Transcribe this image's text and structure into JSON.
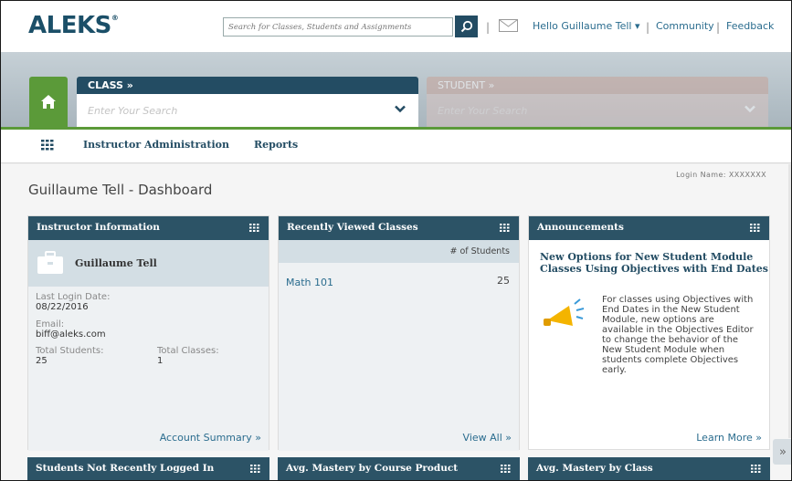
{
  "header": {
    "logo_text": "ALEKS",
    "logo_mark": "®",
    "search_placeholder": "Search for Classes, Students and Assignments",
    "sep1": "|",
    "sep2": "|",
    "sep3": "|",
    "greeting": "Hello Guillaume Tell ▾",
    "community": "Community",
    "feedback": "Feedback"
  },
  "selector": {
    "class_label": "CLASS »",
    "class_placeholder": "Enter Your Search",
    "student_label": "STUDENT »",
    "student_placeholder": "Enter Your Search"
  },
  "nav": {
    "items": [
      "Instructor Administration",
      "Reports"
    ]
  },
  "page": {
    "login_name": "Login Name: XXXXXXX",
    "title": "Guillaume Tell - Dashboard"
  },
  "cards": {
    "instructor": {
      "title": "Instructor Information",
      "name": "Guillaume Tell",
      "last_login_label": "Last Login Date:",
      "last_login_value": "08/22/2016",
      "email_label": "Email:",
      "email_value": "biff@aleks.com",
      "total_students_label": "Total Students:",
      "total_students_value": "25",
      "total_classes_label": "Total Classes:",
      "total_classes_value": "1",
      "footer": "Account Summary »"
    },
    "recent": {
      "title": "Recently Viewed Classes",
      "col_header": "# of Students",
      "rows": [
        {
          "name": "Math 101",
          "count": "25"
        }
      ],
      "footer": "View All »"
    },
    "announcements": {
      "title": "Announcements",
      "heading": "New Options for New Student Module Classes Using Objectives with End Dates",
      "body": "For classes using Objectives with End Dates in the New Student Module, new options are available in the Objectives Editor to change the behavior of the New Student Module when students complete Objectives early.",
      "footer": "Learn More »"
    },
    "bottom": [
      {
        "title": "Students Not Recently Logged In"
      },
      {
        "title": "Avg. Mastery by Course Product"
      },
      {
        "title": "Avg. Mastery by Class"
      }
    ]
  },
  "side_toggle": "»",
  "colors": {
    "primary": "#234c63",
    "green": "#5b9a39",
    "link": "#2a6c8e",
    "student_tint": "#c7a49a"
  }
}
